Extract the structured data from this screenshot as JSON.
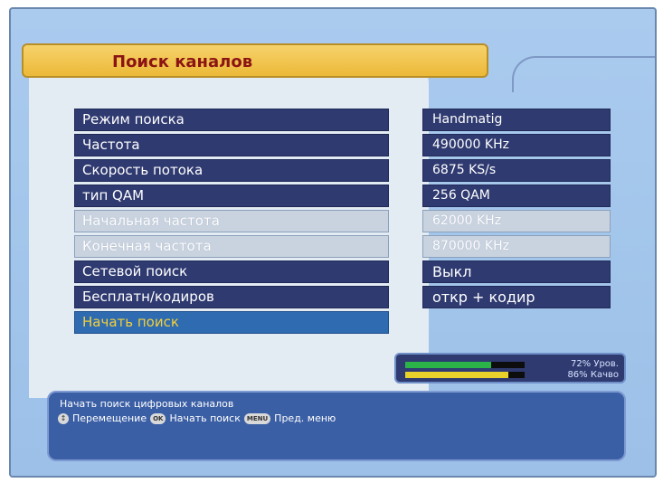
{
  "title": "Поиск каналов",
  "menu": {
    "items": [
      {
        "label": "Режим поиска",
        "state": "normal"
      },
      {
        "label": "Частота",
        "state": "normal"
      },
      {
        "label": "Скорость потока",
        "state": "normal"
      },
      {
        "label": "тип QAM",
        "state": "normal"
      },
      {
        "label": "Начальная частота",
        "state": "disabled"
      },
      {
        "label": "Конечная частота",
        "state": "disabled"
      },
      {
        "label": "Сетевой поиск",
        "state": "normal"
      },
      {
        "label": "Бесплатн/кодиров",
        "state": "normal"
      },
      {
        "label": "Начать поиск",
        "state": "selected"
      }
    ]
  },
  "values": [
    {
      "text": "Handmatig",
      "state": "normal"
    },
    {
      "text": "490000 KHz",
      "state": "normal"
    },
    {
      "text": "6875 KS/s",
      "state": "normal"
    },
    {
      "text": "256 QAM",
      "state": "normal"
    },
    {
      "text": "62000 KHz",
      "state": "disabled"
    },
    {
      "text": "870000 KHz",
      "state": "disabled"
    },
    {
      "text": "Выкл",
      "state": "normal"
    },
    {
      "text": "откр + кодир",
      "state": "normal"
    }
  ],
  "signal": {
    "level_label": "72% Уров.",
    "quality_label": "86% Качво",
    "level_percent": 72,
    "quality_percent": 86,
    "level_color": "#2bb34a",
    "quality_color": "#e7d12a"
  },
  "help": {
    "description": "Начать поиск цифровых каналов",
    "nav_label": "Перемещение",
    "ok_key": "OK",
    "ok_label": "Начать поиск",
    "menu_key": "MENU",
    "menu_label": "Пред. меню"
  }
}
